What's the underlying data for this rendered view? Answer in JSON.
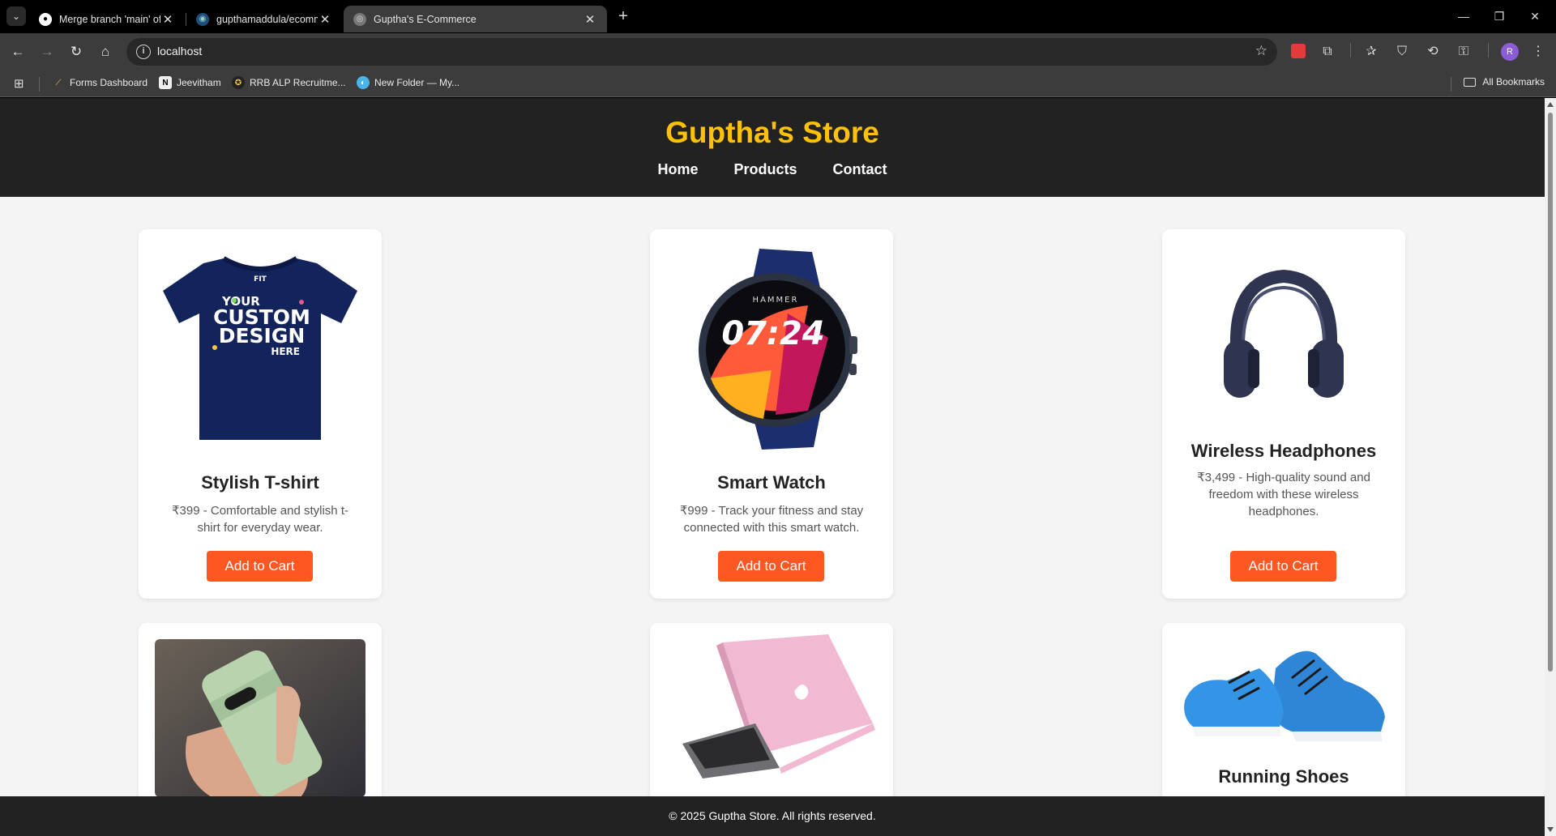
{
  "browser": {
    "tabs": [
      {
        "title": "Merge branch 'main' of https://",
        "close": "✕"
      },
      {
        "title": "gupthamaddula/ecommerce-fr",
        "close": "✕"
      },
      {
        "title": "Guptha's E-Commerce",
        "close": "✕"
      }
    ],
    "new_tab": "+",
    "address": "localhost",
    "profile_initial": "R",
    "bookmarks": [
      {
        "label": "Forms Dashboard"
      },
      {
        "label": "Jeevitham"
      },
      {
        "label": "RRB ALP Recruitme..."
      },
      {
        "label": "New Folder — My..."
      }
    ],
    "all_bookmarks": "All Bookmarks"
  },
  "site": {
    "title": "Guptha's Store",
    "nav": [
      "Home",
      "Products",
      "Contact"
    ],
    "footer": "© 2025 Guptha Store. All rights reserved."
  },
  "products": [
    {
      "name": "Stylish T-shirt",
      "desc": "₹399 - Comfortable and stylish t-shirt for everyday wear.",
      "button": "Add to Cart",
      "image": "navy t-shirt with 'YOUR CUSTOM DESIGN HERE' print",
      "print_lines": [
        "YOUR",
        "CUSTOM",
        "DESIGN",
        "HERE"
      ]
    },
    {
      "name": "Smart Watch",
      "desc": "₹999 - Track your fitness and stay connected with this smart watch.",
      "button": "Add to Cart",
      "image": "navy smart watch",
      "watch_brand": "HAMMER",
      "watch_time": "07:24"
    },
    {
      "name": "Wireless Headphones",
      "desc": "₹3,499 - High-quality sound and freedom with these wireless headphones.",
      "button": "Add to Cart",
      "image": "dark navy over-ear headphones"
    },
    {
      "name": "",
      "image": "hand holding green smartphone"
    },
    {
      "name": "",
      "image": "pink laptop"
    },
    {
      "name": "Running Shoes",
      "image": "blue running shoes"
    }
  ],
  "colors": {
    "header_bg": "#222222",
    "title": "#ffc107",
    "button": "#ff5722",
    "page_bg": "#f4f4f4"
  }
}
